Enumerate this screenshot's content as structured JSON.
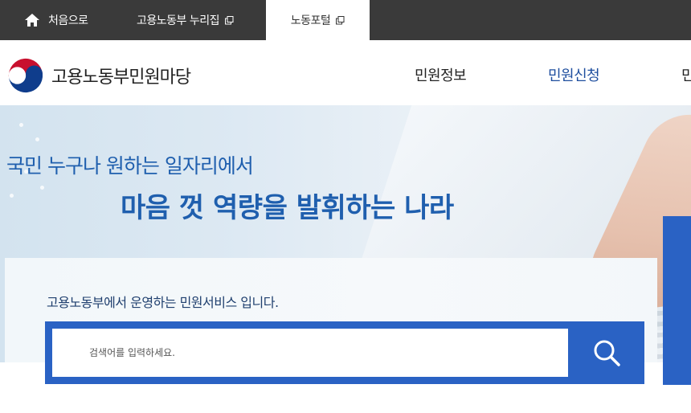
{
  "topbar": {
    "home_label": "처음으로",
    "nuri_label": "고용노동부 누리집",
    "portal_label": "노동포털"
  },
  "header": {
    "logo_text": "고용노동부민원마당",
    "nav": [
      "민원정보",
      "민원신청",
      "민"
    ]
  },
  "hero": {
    "line1": "국민 누구나 원하는 일자리에서",
    "line2": "마음 껏 역량을 발휘하는 나라"
  },
  "search": {
    "description": "고용노동부에서 운영하는 민원서비스 입니다.",
    "placeholder": "검색어를 입력하세요."
  },
  "icons": {
    "home": "home-icon",
    "external": "external-link-icon",
    "search": "search-icon"
  },
  "colors": {
    "topbar": "#3a3a3a",
    "accent_blue": "#2a62c4",
    "hero_text": "#1f5fae",
    "nav_active": "#1e4e9e"
  }
}
